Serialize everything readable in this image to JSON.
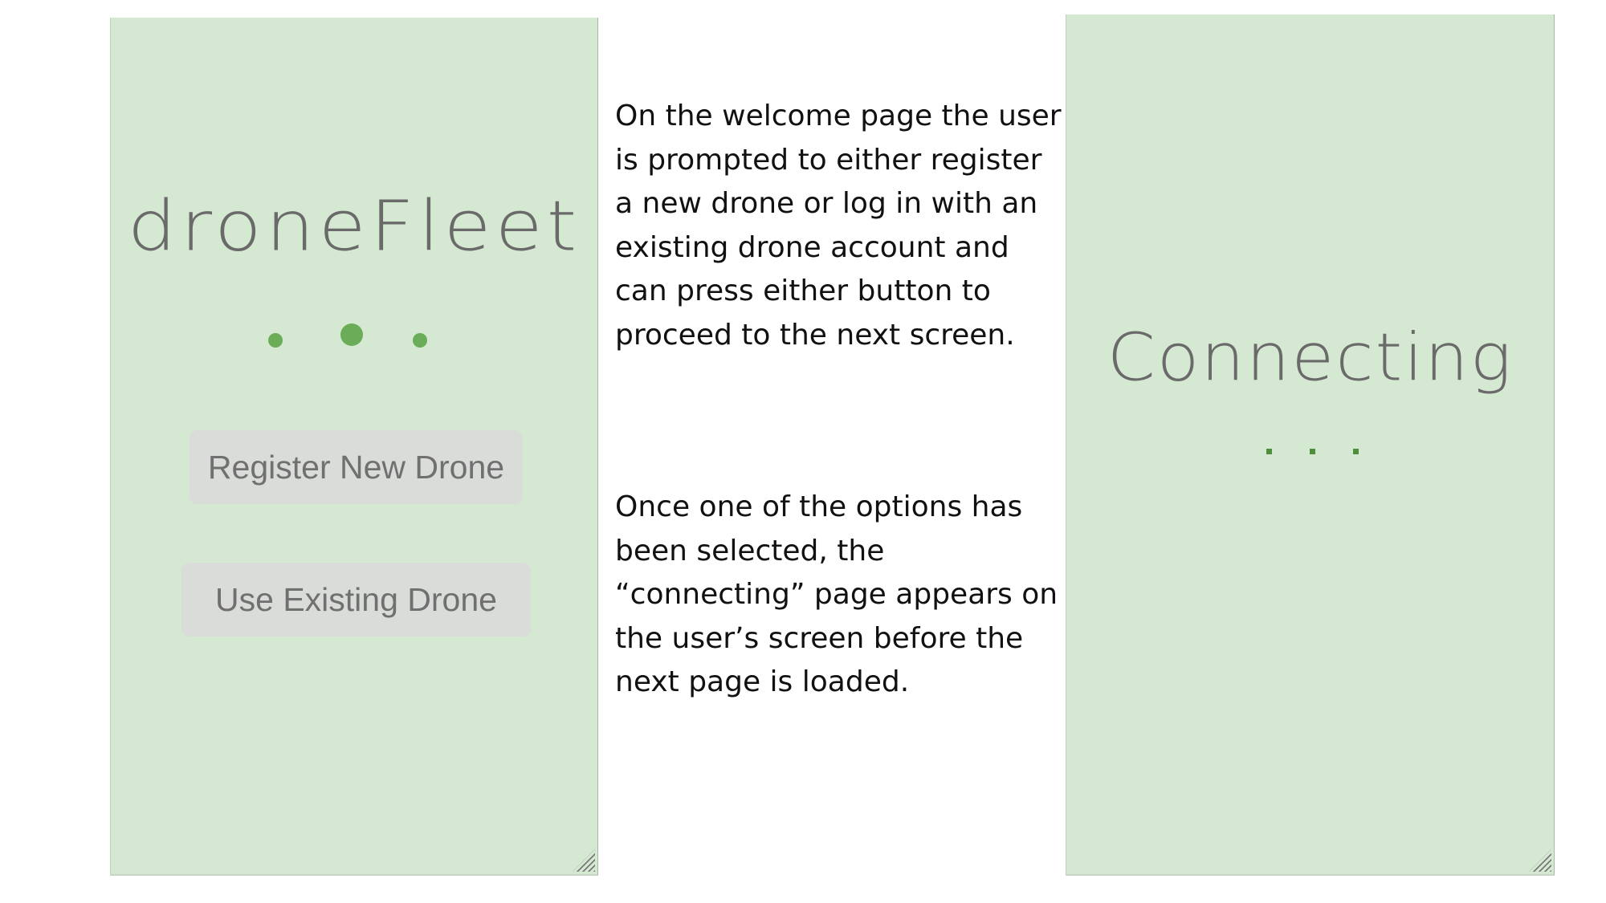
{
  "welcome_screen": {
    "app_title": "droneFleet",
    "register_button_label": "Register New Drone",
    "existing_button_label": "Use Existing Drone",
    "accent_color": "#6aac58",
    "background_color": "#d5e8d1"
  },
  "description": {
    "paragraph_1": "On the welcome page the user is prompted to either register a new drone or log in with an existing drone account and can press either button to proceed to the next screen.",
    "paragraph_2": "Once one of the options has been selected, the “connecting” page  appears on the user’s screen before the next page is loaded."
  },
  "connecting_screen": {
    "title": "Connecting",
    "dot_color": "#4f8f3c"
  }
}
